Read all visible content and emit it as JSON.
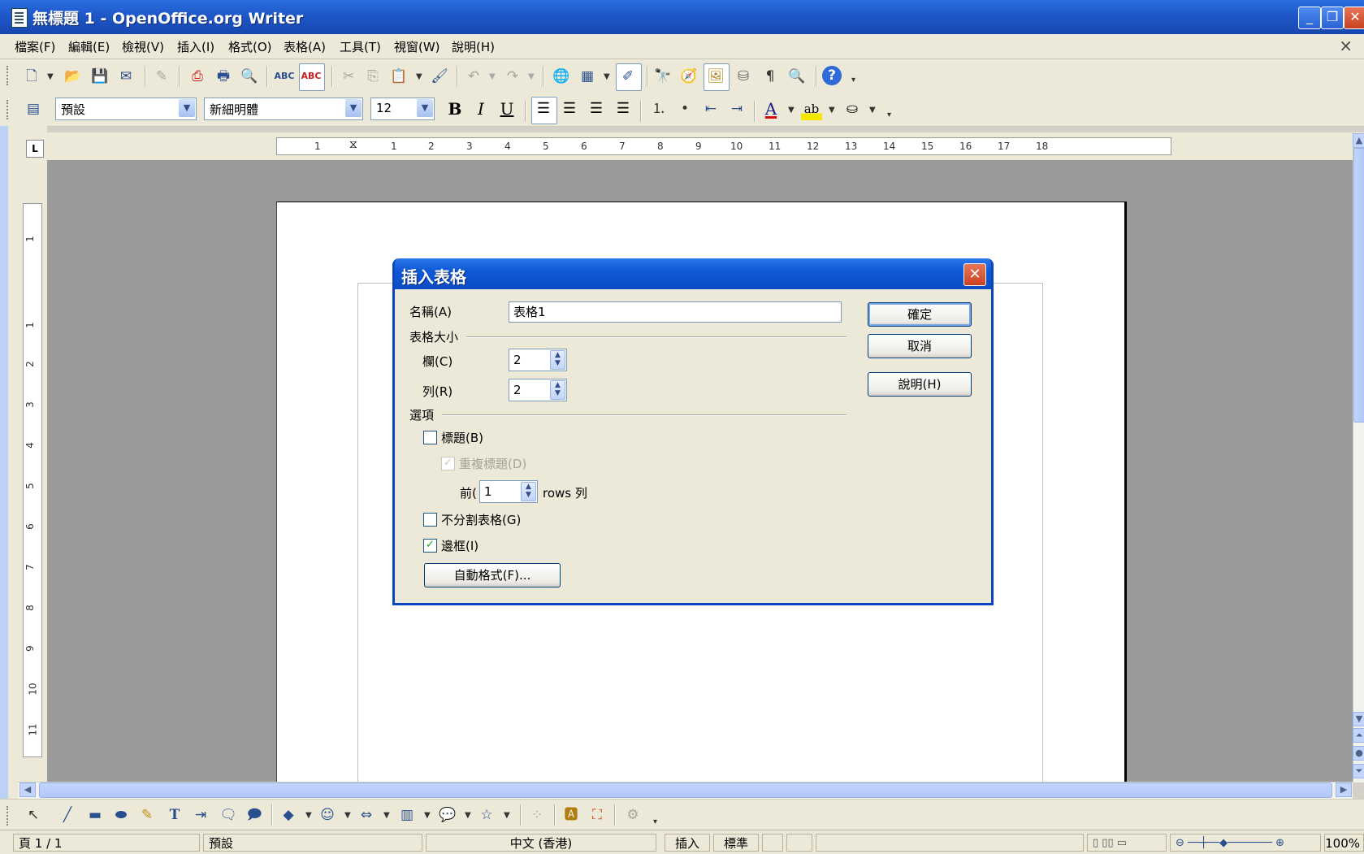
{
  "window": {
    "title": "無標題 1 - OpenOffice.org Writer"
  },
  "menu": [
    "檔案(F)",
    "編輯(E)",
    "檢視(V)",
    "插入(I)",
    "格式(O)",
    "表格(A)",
    "工具(T)",
    "視窗(W)",
    "說明(H)"
  ],
  "formatting": {
    "style": "預設",
    "font": "新細明體",
    "size": "12"
  },
  "ruler": {
    "h_numbers": [
      "1",
      "1",
      "2",
      "3",
      "4",
      "5",
      "6",
      "7",
      "8",
      "9",
      "10",
      "11",
      "12",
      "13",
      "14",
      "15",
      "16",
      "17",
      "18"
    ],
    "v_numbers": [
      "1",
      "1",
      "2",
      "3",
      "4",
      "5",
      "6",
      "7",
      "8",
      "9",
      "10",
      "11"
    ]
  },
  "dialog": {
    "title": "插入表格",
    "name_label": "名稱(A)",
    "name_value": "表格1",
    "size_group": "表格大小",
    "columns_label": "欄(C)",
    "columns_value": "2",
    "rows_label": "列(R)",
    "rows_value": "2",
    "options_group": "選項",
    "heading_label": "標題(B)",
    "repeat_heading_label": "重複標題(D)",
    "first_label": "前(",
    "first_value": "1",
    "rows_suffix": "rows 列",
    "dont_split_label": "不分割表格(G)",
    "border_label": "邊框(I)",
    "autoformat_label": "自動格式(F)...",
    "ok_label": "確定",
    "cancel_label": "取消",
    "help_label": "說明(H)",
    "heading_checked": false,
    "repeat_heading_checked": true,
    "dont_split_checked": false,
    "border_checked": true
  },
  "status": {
    "page": "頁 1 / 1",
    "page_style": "預設",
    "language": "中文 (香港)",
    "insert_mode": "插入",
    "selection_mode": "標準",
    "zoom": "100%"
  },
  "icons": {
    "check": "✓",
    "spin_up": "▲",
    "spin_down": "▼"
  }
}
